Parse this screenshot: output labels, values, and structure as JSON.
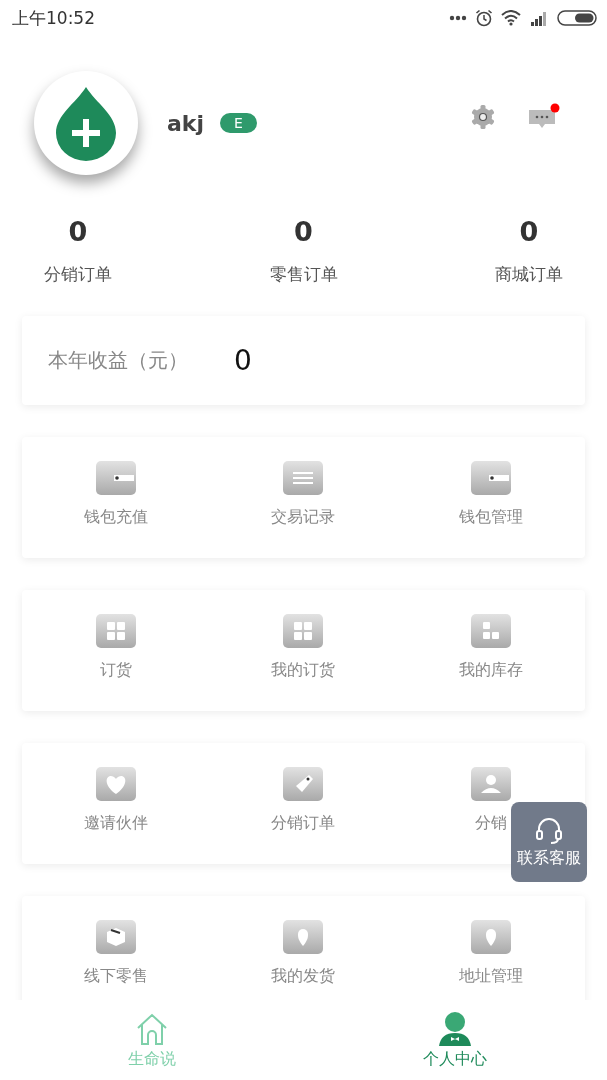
{
  "status_bar": {
    "time": "上午10:52"
  },
  "profile": {
    "name": "akj",
    "level_badge": "E"
  },
  "header_icons": {
    "message_unread": true
  },
  "stats": [
    {
      "value": "0",
      "label": "分销订单"
    },
    {
      "value": "0",
      "label": "零售订单"
    },
    {
      "value": "0",
      "label": "商城订单"
    }
  ],
  "income": {
    "label": "本年收益（元）",
    "value": "0"
  },
  "menu_cards": [
    {
      "items": [
        "钱包充值",
        "交易记录",
        "钱包管理"
      ]
    },
    {
      "items": [
        "订货",
        "我的订货",
        "我的库存"
      ]
    },
    {
      "items": [
        "邀请伙伴",
        "分销订单",
        "分销"
      ]
    },
    {
      "items": [
        "线下零售",
        "我的发货",
        "地址管理"
      ]
    }
  ],
  "floating_button": {
    "label": "联系客服"
  },
  "tabs": [
    {
      "label": "生命说",
      "selected": false
    },
    {
      "label": "个人中心",
      "selected": true
    }
  ]
}
